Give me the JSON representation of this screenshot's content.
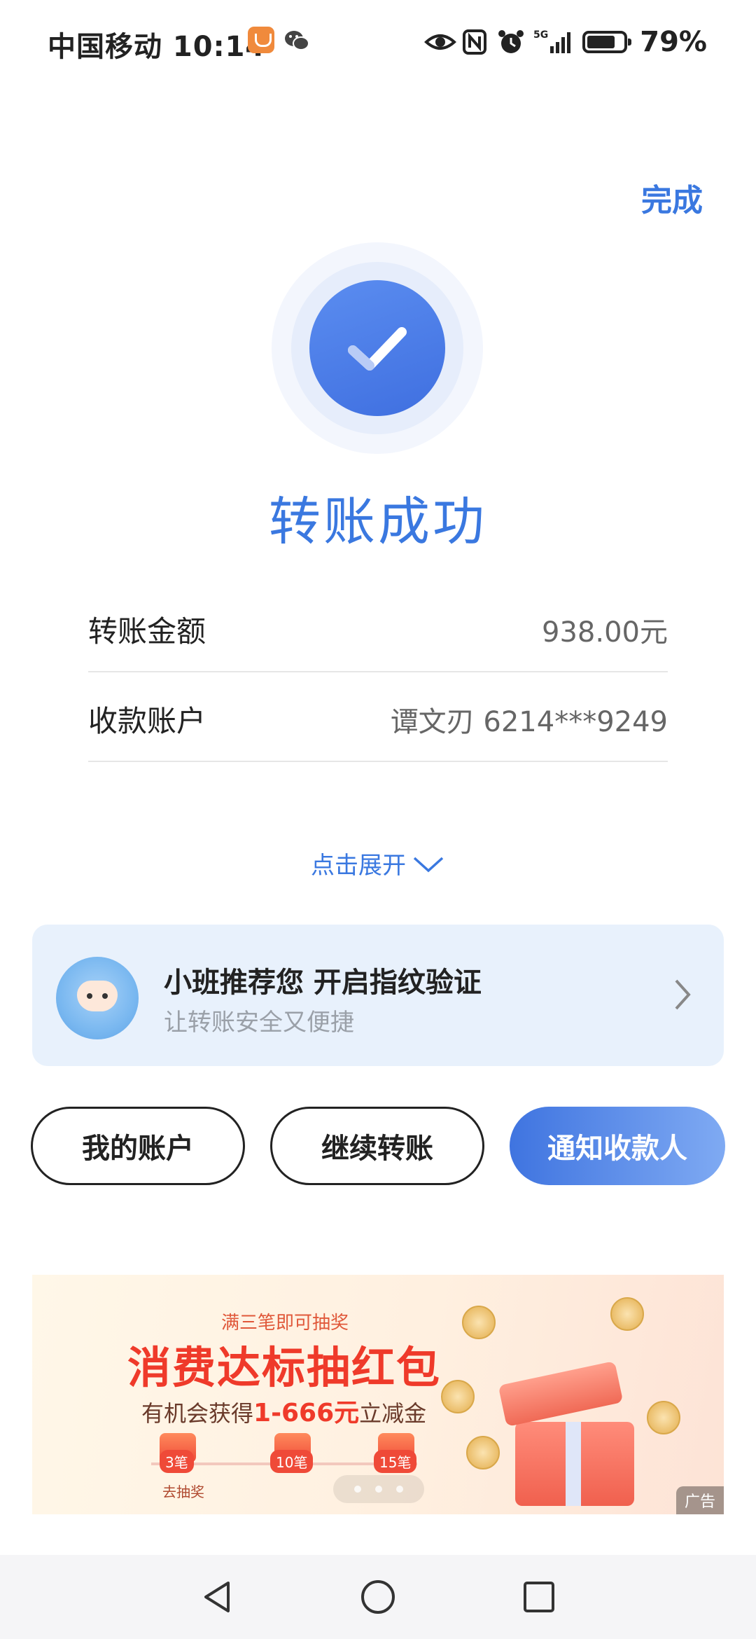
{
  "status_bar": {
    "carrier_time": "中国移动 10:14",
    "network": "5G",
    "battery": "79%"
  },
  "header": {
    "done_label": "完成"
  },
  "result": {
    "title": "转账成功"
  },
  "details": [
    {
      "label": "转账金额",
      "value": "938.00元"
    },
    {
      "label": "收款账户",
      "value": "谭文刃 6214***9249"
    }
  ],
  "expand_label": "点击展开",
  "promo": {
    "title": "小班推荐您 开启指纹验证",
    "subtitle": "让转账安全又便捷"
  },
  "actions": {
    "my_account": "我的账户",
    "continue_transfer": "继续转账",
    "notify_payee": "通知收款人"
  },
  "banner": {
    "top_text": "满三笔即可抽奖",
    "title": "消费达标抽红包",
    "subtitle_prefix": "有机会获得",
    "subtitle_highlight": "1-666元",
    "subtitle_suffix": "立减金",
    "milestones": [
      "3笔",
      "10笔",
      "15笔"
    ],
    "go_label": "去抽奖",
    "ad_label": "广告"
  },
  "colors": {
    "accent": "#3a78e0",
    "banner_red": "#ef3a2a"
  }
}
